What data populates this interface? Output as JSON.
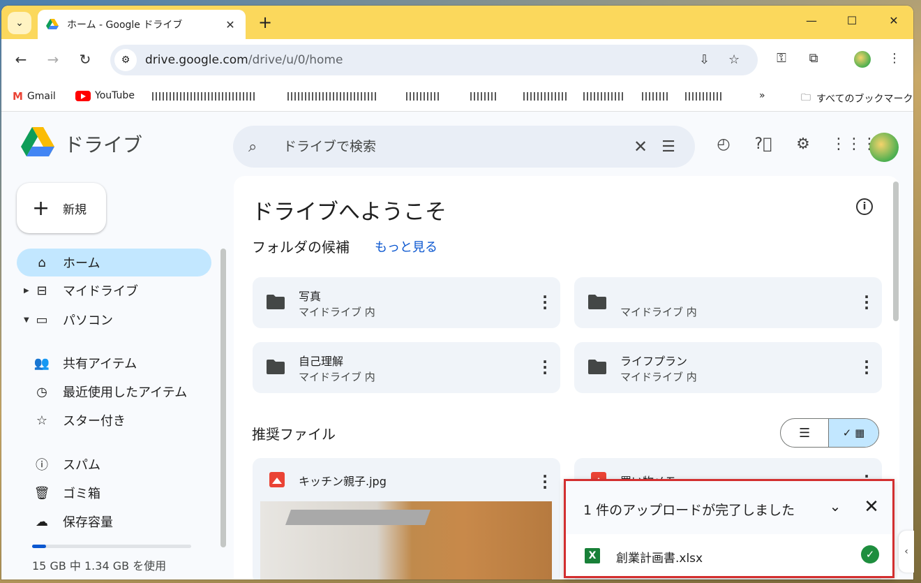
{
  "browser": {
    "tab_title": "ホーム - Google ドライブ",
    "url_host": "drive.google.com",
    "url_path": "/drive/u/0/home",
    "bookmarks": [
      {
        "label": "Gmail"
      },
      {
        "label": "YouTube"
      }
    ],
    "all_bookmarks_label": "すべてのブックマーク"
  },
  "app": {
    "name": "ドライブ",
    "search_placeholder": "ドライブで検索"
  },
  "sidebar": {
    "new_label": "新規",
    "items": [
      {
        "label": "ホーム",
        "icon": "home-icon"
      },
      {
        "label": "マイドライブ",
        "icon": "my-drive-icon"
      },
      {
        "label": "パソコン",
        "icon": "computers-icon"
      },
      {
        "label": "共有アイテム",
        "icon": "people-icon"
      },
      {
        "label": "最近使用したアイテム",
        "icon": "clock-icon"
      },
      {
        "label": "スター付き",
        "icon": "star-icon"
      },
      {
        "label": "スパム",
        "icon": "spam-icon"
      },
      {
        "label": "ゴミ箱",
        "icon": "trash-icon"
      },
      {
        "label": "保存容量",
        "icon": "cloud-icon"
      }
    ],
    "storage_text": "15 GB 中 1.34 GB を使用",
    "storage_fraction": 0.089
  },
  "main": {
    "title": "ドライブへようこそ",
    "folders_label": "フォルダの候補",
    "more_label": "もっと見る",
    "folders": [
      {
        "name": "写真",
        "location": "マイドライブ 内"
      },
      {
        "name": "",
        "location": "マイドライブ 内"
      },
      {
        "name": "自己理解",
        "location": "マイドライブ 内"
      },
      {
        "name": "ライフプラン",
        "location": "マイドライブ 内"
      }
    ],
    "files_label": "推奨ファイル",
    "files": [
      {
        "name": "キッチン親子.jpg"
      },
      {
        "name": "買い物メモ.png"
      }
    ]
  },
  "upload": {
    "title": "1 件のアップロードが完了しました",
    "file_name": "創業計画書.xlsx"
  },
  "colors": {
    "tabstrip": "#fbd85c",
    "active_nav": "#c2e7ff",
    "accent": "#0b57d0",
    "highlight_border": "#d32f2f"
  }
}
